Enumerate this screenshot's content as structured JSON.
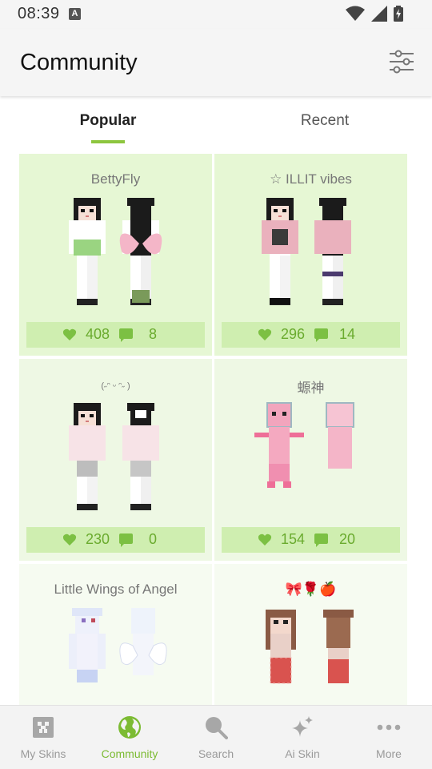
{
  "status": {
    "time": "08:39",
    "notif_letter": "A"
  },
  "header": {
    "title": "Community",
    "filter_icon": "sliders-icon"
  },
  "tabs": [
    {
      "label": "Popular",
      "active": true
    },
    {
      "label": "Recent",
      "active": false
    }
  ],
  "cards": [
    {
      "title": "BettyFly",
      "likes": "408",
      "comments": "8",
      "bg": "#e6f7d4"
    },
    {
      "title": "☆ ILLIT vibes",
      "likes": "296",
      "comments": "14",
      "bg": "#e6f7d4"
    },
    {
      "title": "(˶ᵔ ᵕ ᵔ˶ )",
      "likes": "230",
      "comments": "0",
      "bg": "#eef8e4"
    },
    {
      "title": "螈神",
      "likes": "154",
      "comments": "20",
      "bg": "#eef8e4"
    },
    {
      "title": "Little Wings of Angel",
      "bg": "#f6fbf1"
    },
    {
      "title": "🎀🌹🍎",
      "bg": "#f6fbf1"
    }
  ],
  "nav": [
    {
      "label": "My Skins",
      "icon": "block-icon",
      "active": false
    },
    {
      "label": "Community",
      "icon": "globe-icon",
      "active": true
    },
    {
      "label": "Search",
      "icon": "search-icon",
      "active": false
    },
    {
      "label": "Ai Skin",
      "icon": "sparkle-icon",
      "active": false
    },
    {
      "label": "More",
      "icon": "more-dots-icon",
      "active": false
    }
  ],
  "colors": {
    "accent": "#8dc63f",
    "stat_text": "#6aab2e",
    "stat_bg": "#cfeeb0"
  }
}
